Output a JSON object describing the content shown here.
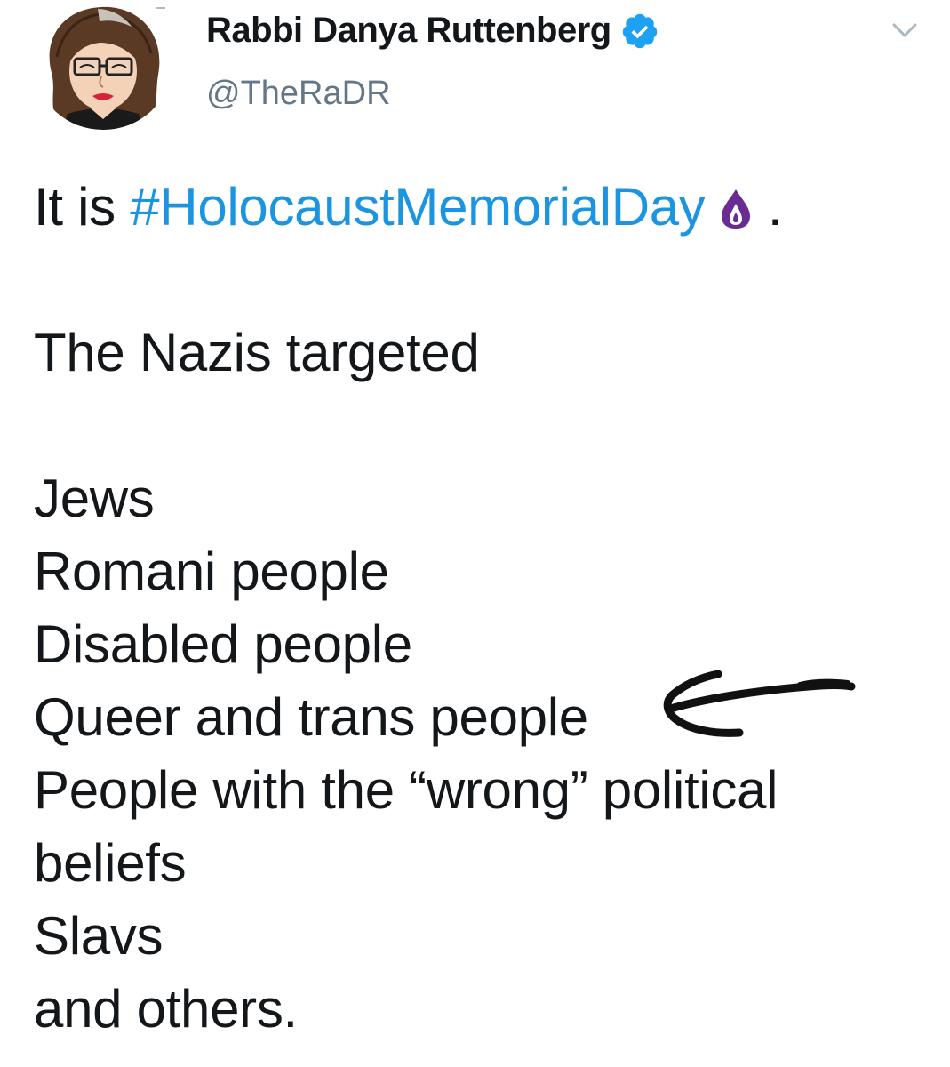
{
  "tweet": {
    "author": {
      "display_name": "Rabbi Danya Ruttenberg",
      "handle": "@TheRaDR",
      "verified": true,
      "avatar_icon": "cartoon-portrait-avatar"
    },
    "menu_icon": "chevron-down-icon",
    "text": {
      "line1_prefix": "It is ",
      "hashtag": "#HolocaustMemorialDay",
      "candle_emoji": "memorial-candle-icon",
      "line1_suffix": " .",
      "intro": "The Nazis targeted",
      "groups": [
        "Jews",
        "Romani people",
        "Disabled people",
        "Queer and trans people",
        "People with the “wrong” political",
        "beliefs",
        "Slavs",
        "and others."
      ]
    },
    "annotation": "hand-drawn-arrow-pointing-at-queer-and-trans-people"
  },
  "colors": {
    "text": "#14171a",
    "secondary": "#657786",
    "link": "#1b95e0",
    "verified_badge": "#1da1f2",
    "candle": "#6a2c91"
  }
}
